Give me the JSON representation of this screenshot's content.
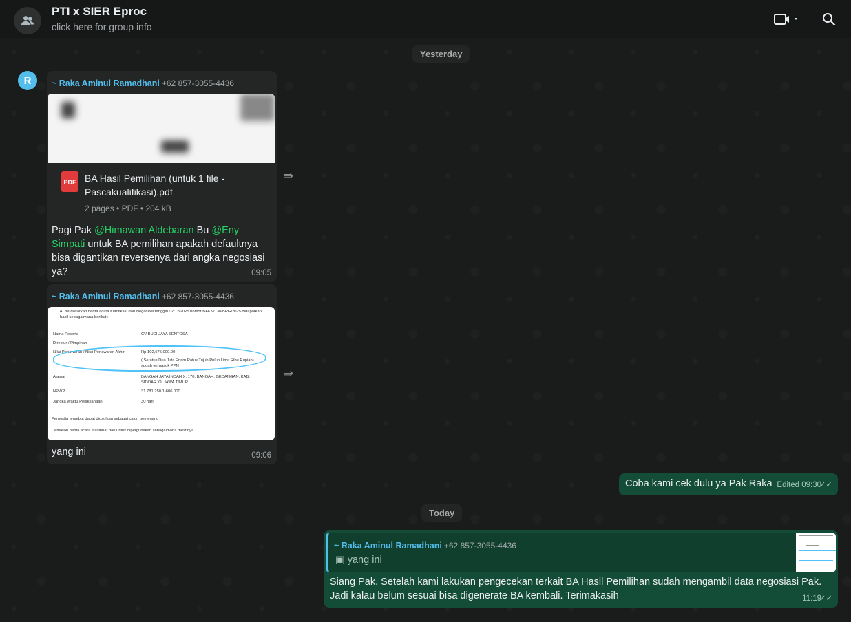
{
  "header": {
    "title": "PTI x SIER Eproc",
    "subtitle": "click here for group info"
  },
  "dates": {
    "yesterday": "Yesterday",
    "today": "Today"
  },
  "messages": [
    {
      "avatar_letter": "R",
      "sender": "~ Raka Aminul Ramadhani",
      "phone": "+62 857-3055-4436",
      "document": {
        "name": "BA Hasil Pemilihan (untuk 1 file - Pascakualifikasi).pdf",
        "meta": "2 pages • PDF • 204 kB",
        "icon_label": "PDF"
      },
      "text_parts": [
        "Pagi Pak ",
        "@Himawan Aldebaran",
        " Bu ",
        "@Eny Simpati",
        " untuk BA pemilihan apakah defaultnya bisa digantikan reversenya dari angka negosiasi ya?"
      ],
      "time": "09:05"
    },
    {
      "sender": "~ Raka Aminul Ramadhani",
      "phone": "+62 857-3055-4436",
      "image_text": {
        "intro": "4. Berdasarkan berita acara Klarifikasi dan Negosiasi tanggal 02/12/2025 nomor BAKN/138/BRG/2025 didapatkan hasil sebagaimana berikut :",
        "rows": [
          [
            "Nama Peserta",
            "CV BUDI JAYA SENTOSA"
          ],
          [
            "Direktur / Pimpinan",
            ""
          ],
          [
            "Nilai Penawaran / Nilai Penawaran Akhir",
            "Rp.102,675,000.00"
          ],
          [
            "",
            "( Seratus Dua Juta Enam Ratus Tujuh Puluh Lima Ribu Rupiah) sudah termasuk PPN"
          ],
          [
            "Alamat",
            "BANGAH JAYA INDAH X, 170, BANGAH, GEDANGAN, KAB. SIDOARJO, JAWA TIMUR"
          ],
          [
            "NPWP",
            "31.781.250.1-606.000"
          ],
          [
            "Jangka Waktu Pelaksanaan",
            "30 hari"
          ]
        ],
        "note1": "Penyedia tersebut dapat diusulkan sebagai calon pemenang",
        "note2": "Demikian berita acara ini dibuat dan untuk dipergunakan sebagaimana mestinya."
      },
      "text": "yang ini",
      "time": "09:06"
    },
    {
      "text": "Coba kami cek dulu ya Pak Raka",
      "time": "Edited 09:30",
      "status": "read"
    },
    {
      "quote": {
        "sender": "~ Raka Aminul Ramadhani",
        "phone": "+62 857-3055-4436",
        "text": "yang ini"
      },
      "text": "Siang Pak, Setelah kami lakukan pengecekan terkait BA Hasil Pemilihan sudah mengambil data negosiasi Pak. Jadi kalau belum sesuai bisa digenerate BA kembali. Terimakasih",
      "time": "11:19",
      "status": "read"
    }
  ]
}
